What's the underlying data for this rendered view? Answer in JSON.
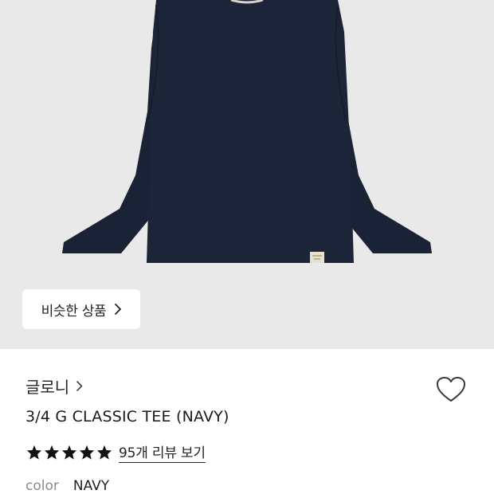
{
  "hero": {
    "product_color": "#1c2438",
    "background_color": "#e9e9e9",
    "similar_button_label": "비슷한 상품"
  },
  "product": {
    "brand": "글로니",
    "title": "3/4 G CLASSIC TEE (NAVY)",
    "rating_stars": 5,
    "rating_max": 5,
    "review_link": "95개 리뷰 보기",
    "color_label": "color",
    "color_value": "NAVY"
  },
  "icons": {
    "similar_chevron": "chevron-right-icon",
    "brand_chevron": "chevron-right-icon",
    "wishlist": "heart-outline-icon",
    "star": "star-filled-icon"
  }
}
